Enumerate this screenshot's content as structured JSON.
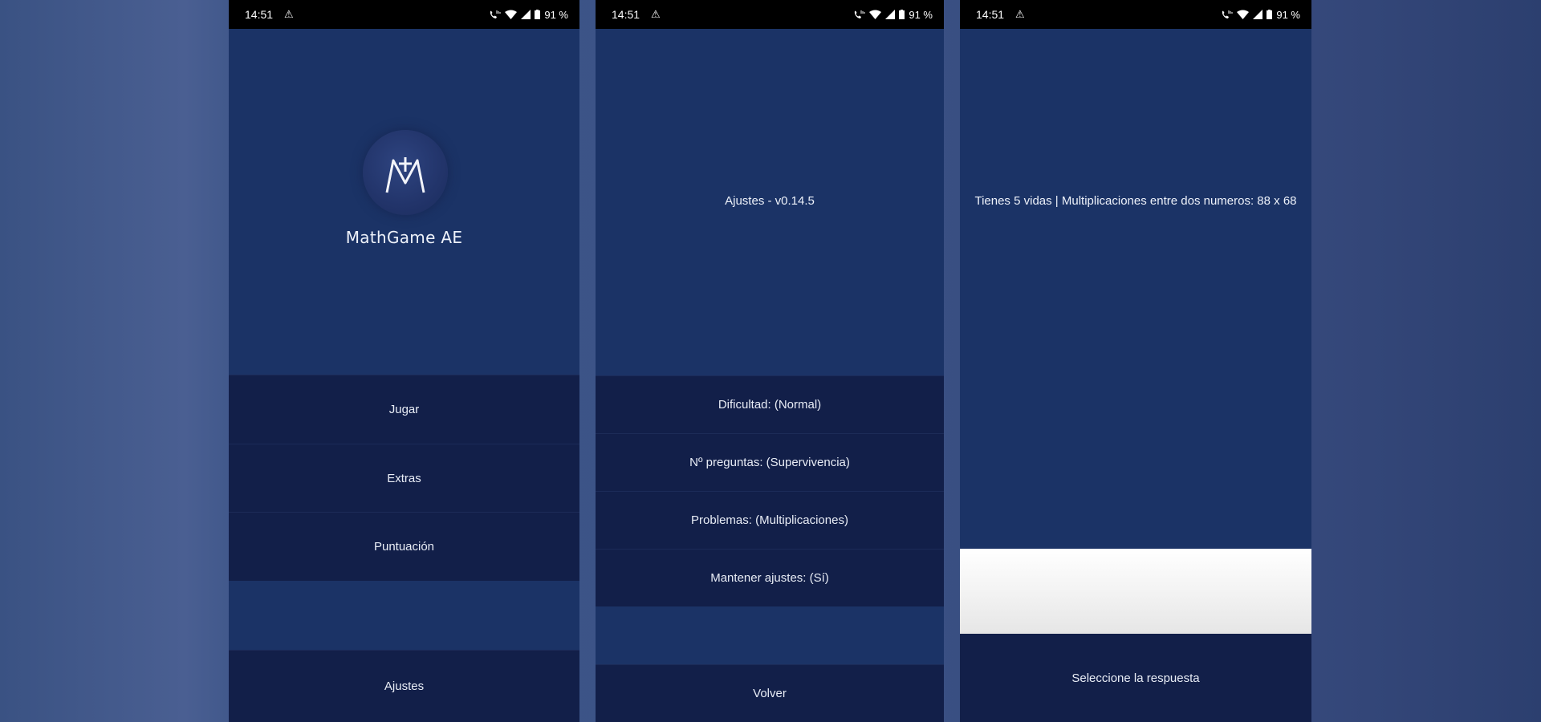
{
  "status_bar": {
    "time": "14:51",
    "battery": "91 %"
  },
  "colors": {
    "screen_bg": "#1b3366",
    "button_bg": "#121f49",
    "page_bg": "#3b5286",
    "answer_area": "#f3f3f3"
  },
  "home": {
    "app_name": "MathGame AE",
    "logo_icon": "mathgame-logo-icon",
    "menu": {
      "play": "Jugar",
      "extras": "Extras",
      "score": "Puntuación",
      "settings": "Ajustes"
    }
  },
  "settings": {
    "title": "Ajustes - v0.14.5",
    "options": {
      "difficulty": "Dificultad: (Normal)",
      "questions": "Nº preguntas: (Supervivencia)",
      "problems": "Problemas: (Multiplicaciones)",
      "keep_settings": "Mantener ajustes: (Sí)"
    },
    "back": "Volver"
  },
  "game": {
    "question": "Tienes 5 vidas | Multiplicaciones entre dos numeros: 88 x 68",
    "prompt": "Seleccione la respuesta"
  }
}
